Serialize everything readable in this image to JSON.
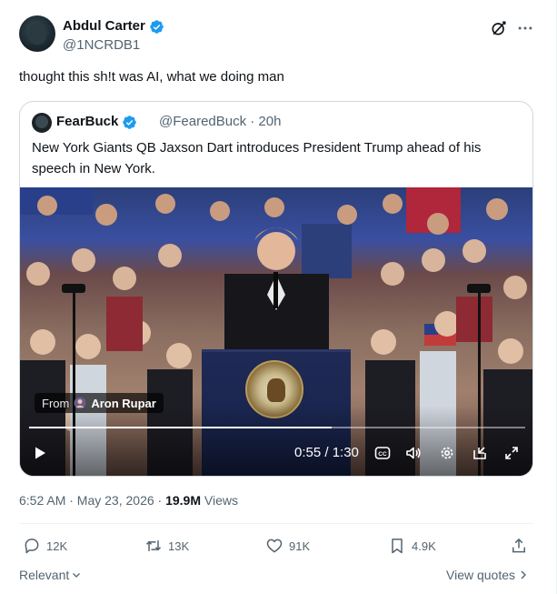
{
  "author": {
    "name": "Abdul Carter",
    "handle": "@1NCRDB1",
    "avatar_icon": "avatar"
  },
  "post": {
    "text": "thought this sh!t was AI, what we doing man",
    "timestamp": "6:52 AM · May 23, 2026 · ",
    "views_count": "19.9M",
    "views_label": " Views"
  },
  "quote": {
    "name": "FearBuck",
    "handle_time": "@FearedBuck · 20h",
    "text": "New York Giants QB Jaxson Dart introduces President Trump ahead of his speech in New York.",
    "video": {
      "attribution_prefix": "From",
      "attribution_source": "Aron Rupar",
      "time": "0:55 / 1:30",
      "progress": 0.61
    }
  },
  "actions": {
    "replies": "12K",
    "reposts": "13K",
    "likes": "91K",
    "bookmarks": "4.9K"
  },
  "footer": {
    "relevant": "Relevant",
    "view_quotes": "View quotes"
  },
  "colors": {
    "verified": "#1d9bf0",
    "secondary_text": "#536471",
    "primary_text": "#0f1419"
  }
}
